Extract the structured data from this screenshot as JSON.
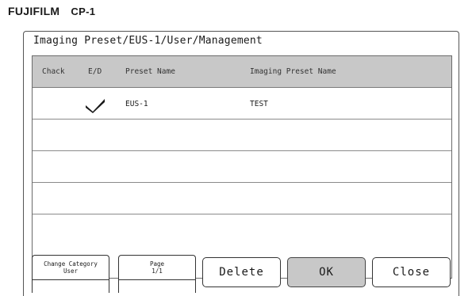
{
  "brand": {
    "logo": "FUJIFILM",
    "model": "CP-1"
  },
  "window": {
    "title": "Imaging Preset/EUS-1/User/Management"
  },
  "table": {
    "columns": [
      "Chack",
      "E/D",
      "Preset Name",
      "Imaging Preset Name"
    ],
    "rows": [
      {
        "enabled": true,
        "check_icon": "checkmark-icon",
        "preset_name": "EUS-1",
        "imaging_preset_name": "TEST"
      },
      {
        "enabled": false,
        "preset_name": "",
        "imaging_preset_name": ""
      },
      {
        "enabled": false,
        "preset_name": "",
        "imaging_preset_name": ""
      },
      {
        "enabled": false,
        "preset_name": "",
        "imaging_preset_name": ""
      },
      {
        "enabled": false,
        "preset_name": "",
        "imaging_preset_name": ""
      }
    ]
  },
  "buttons": {
    "change_category": {
      "line1": "Change Category",
      "line2": "User"
    },
    "page": {
      "line1": "Page",
      "line2": "1/1"
    },
    "delete": "Delete",
    "ok": "OK",
    "close": "Close"
  },
  "colors": {
    "header_bg": "#c8c8c8",
    "ok_bg": "#c8c8c8",
    "border": "#333333"
  }
}
